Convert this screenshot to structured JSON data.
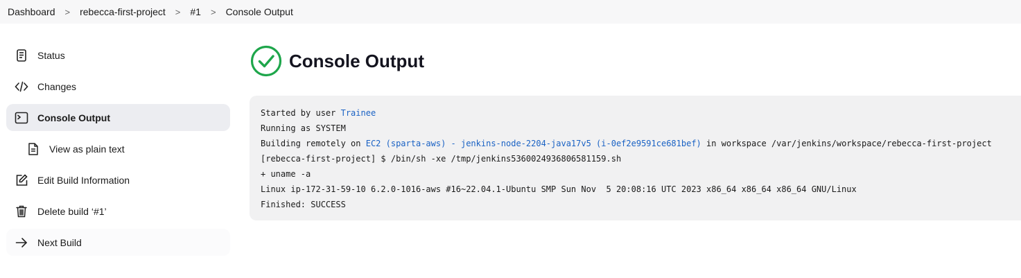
{
  "breadcrumb": {
    "items": [
      "Dashboard",
      "rebecca-first-project",
      "#1",
      "Console Output"
    ],
    "separator": ">"
  },
  "sidebar": {
    "items": [
      {
        "label": "Status",
        "icon": "document-icon"
      },
      {
        "label": "Changes",
        "icon": "code-icon"
      },
      {
        "label": "Console Output",
        "icon": "terminal-icon",
        "active": true
      },
      {
        "label": "View as plain text",
        "icon": "file-text-icon"
      },
      {
        "label": "Edit Build Information",
        "icon": "edit-icon"
      },
      {
        "label": "Delete build ‘#1’",
        "icon": "trash-icon"
      },
      {
        "label": "Next Build",
        "icon": "arrow-right-icon"
      }
    ]
  },
  "main": {
    "title": "Console Output",
    "status_icon": "success-check-icon",
    "status_color": "#1ea64b",
    "console": {
      "line1_prefix": "Started by user ",
      "line1_user": "Trainee",
      "line2": "Running as SYSTEM",
      "line3_prefix": "Building remotely on ",
      "line3_node": "EC2 (sparta-aws) - jenkins-node-2204-java17v5 (i-0ef2e9591ce681bef)",
      "line3_suffix": " in workspace /var/jenkins/workspace/rebecca-first-project",
      "line4": "[rebecca-first-project] $ /bin/sh -xe /tmp/jenkins5360024936806581159.sh",
      "line5": "+ uname -a",
      "line6": "Linux ip-172-31-59-10 6.2.0-1016-aws #16~22.04.1-Ubuntu SMP Sun Nov  5 20:08:16 UTC 2023 x86_64 x86_64 x86_64 GNU/Linux",
      "line7": "Finished: SUCCESS"
    },
    "link_color": "#1a62c4"
  }
}
